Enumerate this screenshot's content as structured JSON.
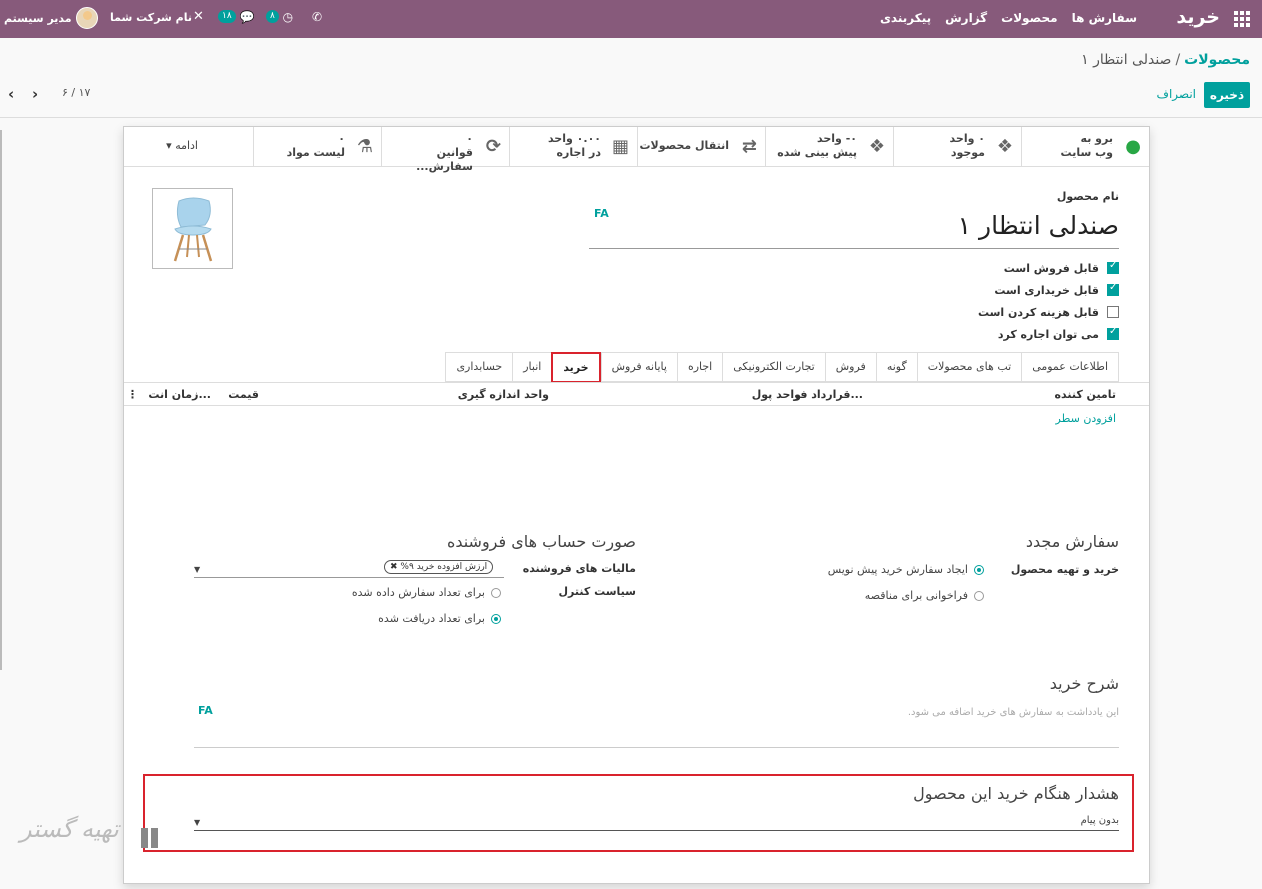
{
  "navbar": {
    "brand": "خرید",
    "menu": [
      "سفارش ها",
      "محصولات",
      "گزارش",
      "پیکربندی"
    ],
    "user": "مدیر سیستم",
    "company": "نام شرکت شما",
    "chat_count": "۱۸",
    "activity_count": "۸",
    "close_glyph": "✕",
    "chat_glyph": "💬",
    "activity_glyph": "◷",
    "phone_glyph": "✆"
  },
  "control_panel": {
    "breadcrumb_parent": "محصولات",
    "breadcrumb_sep": "/",
    "breadcrumb_current": "صندلی انتظار ۱",
    "save": "ذخیره",
    "discard": "انصراف",
    "pager": "۶ / ۱۷",
    "prev": "‹",
    "next": "›"
  },
  "smart_buttons": [
    {
      "icon": "globe-icon",
      "glyph": "●",
      "line1": "برو به",
      "line2": "وب سایت"
    },
    {
      "icon": "cubes-icon",
      "glyph": "❖",
      "line1": "۰ واحد",
      "line2": "موجود"
    },
    {
      "icon": "cubes-icon",
      "glyph": "❖",
      "line1": "۰- واحد",
      "line2": "پیش بینی شده"
    },
    {
      "icon": "exchange-icon",
      "glyph": "⇄",
      "line1": "انتقال محصولات",
      "line2": ""
    },
    {
      "icon": "calendar-icon",
      "glyph": "▦",
      "line1": "۰.۰۰ واحد",
      "line2": "در اجاره"
    },
    {
      "icon": "refresh-icon",
      "glyph": "⟳",
      "line1": "۰",
      "line2": "قوانین سفارش..."
    },
    {
      "icon": "flask-icon",
      "glyph": "⚗",
      "line1": "۰",
      "line2": "لیست مواد"
    },
    {
      "icon": "caret-down-icon",
      "glyph": "▾",
      "line1": "ادامه",
      "line2": ""
    }
  ],
  "product": {
    "name_label": "نام محصول",
    "name": "صندلی انتظار ۱",
    "lang_tag": "FA",
    "checks": [
      {
        "label": "قابل فروش است",
        "checked": true
      },
      {
        "label": "قابل خریداری است",
        "checked": true
      },
      {
        "label": "قابل هزینه کردن است",
        "checked": false
      },
      {
        "label": "می توان اجاره کرد",
        "checked": true
      }
    ]
  },
  "tabs": [
    "اطلاعات عمومی",
    "تب های محصولات",
    "گونه",
    "فروش",
    "تجارت الکترونیکی",
    "اجاره",
    "پایانه فروش",
    "خرید",
    "انبار",
    "حسابداری"
  ],
  "active_tab": "خرید",
  "vendor_table": {
    "columns": [
      "تامین کننده",
      "قرارداد فر...",
      "واحد پول",
      "واحد اندازه گیری",
      "قیمت",
      "زمان انت..."
    ],
    "add_line": "افزودن سطر",
    "options_glyph": "⋮"
  },
  "reorder": {
    "title": "سفارش مجدد",
    "field_label": "خرید و تهیه محصول",
    "options": [
      {
        "label": "ایجاد سفارش خرید پیش نویس",
        "selected": true
      },
      {
        "label": "فراخوانی برای مناقصه",
        "selected": false
      }
    ]
  },
  "vendor_bills": {
    "title": "صورت حساب های فروشنده",
    "tax_label": "مالیات های فروشنده",
    "tax_tag": "ارزش افزوده خرید ۹%",
    "tag_remove": "✖",
    "control_label": "سیاست کنترل",
    "control_options": [
      {
        "label": "برای تعداد سفارش داده شده",
        "selected": false
      },
      {
        "label": "برای تعداد دریافت شده",
        "selected": true
      }
    ]
  },
  "description": {
    "title": "شرح خرید",
    "placeholder": "این یادداشت به سفارش های خرید اضافه می شود.",
    "lang_tag": "FA"
  },
  "warning": {
    "title": "هشدار هنگام خرید این محصول",
    "value": "بدون پیام"
  },
  "watermark": "تهیه گستر",
  "colors": {
    "primary": "#875A7B",
    "accent": "#00A09D",
    "highlight": "#d9232d"
  }
}
